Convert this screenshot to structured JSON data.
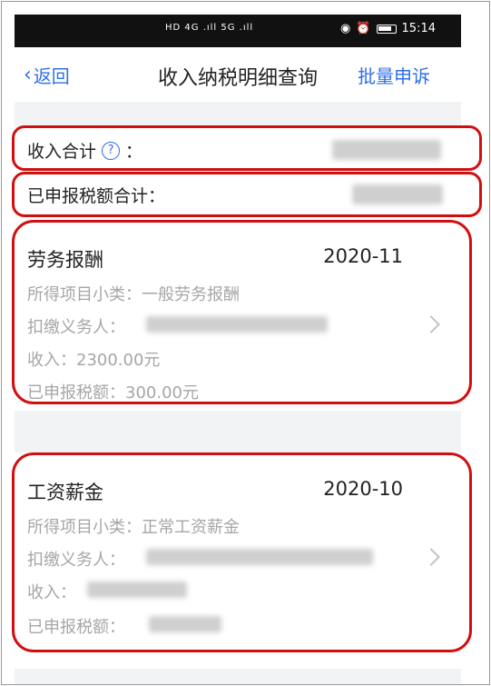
{
  "status_bar": {
    "network": "HD 4G .ıll 5G .ıll",
    "time": "15:14"
  },
  "nav": {
    "back_label": "返回",
    "title": "收入纳税明细查询",
    "action_label": "批量申诉"
  },
  "summary": {
    "income_total_label": "收入合计",
    "income_total_colon": "：",
    "declared_tax_total_label": "已申报税额合计："
  },
  "records": [
    {
      "type": "劳务报酬",
      "period": "2020-11",
      "subcategory": "所得项目小类：一般劳务报酬",
      "withholder": "扣缴义务人：",
      "income": "收入：2300.00元",
      "declared_tax": "已申报税额：300.00元"
    },
    {
      "type": "工资薪金",
      "period": "2020-10",
      "subcategory": "所得项目小类：正常工资薪金",
      "withholder": "扣缴义务人：",
      "income": "收入：",
      "declared_tax": "已申报税额："
    }
  ],
  "colors": {
    "accent": "#2f6fe8",
    "highlight": "#d01010",
    "muted_text": "#a6a6a6",
    "band": "#f2f3f5"
  }
}
